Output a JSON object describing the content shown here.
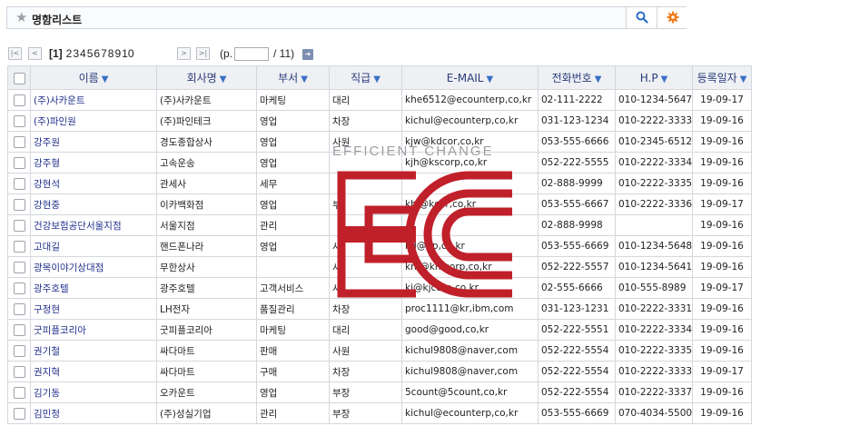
{
  "header": {
    "title": "명함리스트",
    "star_icon": "star-icon",
    "search_icon": "search-icon",
    "settings_icon": "gear-icon",
    "accent": "#f07a1a"
  },
  "pager": {
    "first": "|<",
    "prev": "<",
    "current": "[1]",
    "pages": [
      "2",
      "3",
      "4",
      "5",
      "6",
      "7",
      "8",
      "9",
      "10"
    ],
    "next": ">",
    "last": ">|",
    "page_prefix": "(p.",
    "page_value": "",
    "page_total": "/ 11)"
  },
  "table": {
    "columns": [
      "이름",
      "회사명",
      "부서",
      "직급",
      "E-MAIL",
      "전화번호",
      "H.P",
      "등록일자"
    ],
    "rows": [
      {
        "name": "(주)사카운트",
        "company": "(주)사카운트",
        "dept": "마케팅",
        "rank": "대리",
        "email": "khe6512@ecounterp,co,kr",
        "tel": "02-111-2222",
        "hp": "010-1234-5647",
        "date": "19-09-17"
      },
      {
        "name": "(주)파인원",
        "company": "(주)파인테크",
        "dept": "영업",
        "rank": "차장",
        "email": "kichul@ecounterp,co,kr",
        "tel": "031-123-1234",
        "hp": "010-2222-3333",
        "date": "19-09-16"
      },
      {
        "name": "강주원",
        "company": "경도종합상사",
        "dept": "영업",
        "rank": "사원",
        "email": "kjw@kdcor,co,kr",
        "tel": "053-555-6666",
        "hp": "010-2345-6512",
        "date": "19-09-16"
      },
      {
        "name": "강주형",
        "company": "고속운송",
        "dept": "영업",
        "rank": "",
        "email": "kjh@kscorp,co,kr",
        "tel": "052-222-5555",
        "hp": "010-2222-3334",
        "date": "19-09-16"
      },
      {
        "name": "강현석",
        "company": "관세사",
        "dept": "세무",
        "rank": "",
        "email": "",
        "tel": "02-888-9999",
        "hp": "010-2222-3335",
        "date": "19-09-16"
      },
      {
        "name": "강현중",
        "company": "이카백화점",
        "dept": "영업",
        "rank": "부",
        "email": "khj@kcor,co,kr",
        "tel": "053-555-6667",
        "hp": "010-2222-3336",
        "date": "19-09-17"
      },
      {
        "name": "건강보험공단서울지점",
        "company": "서울지점",
        "dept": "관리",
        "rank": "",
        "email": "",
        "tel": "02-888-9998",
        "hp": "",
        "date": "19-09-16"
      },
      {
        "name": "고대길",
        "company": "핸드폰나라",
        "dept": "영업",
        "rank": "사",
        "email": "kd@hp,co,kr",
        "tel": "053-555-6669",
        "hp": "010-1234-5648",
        "date": "19-09-16"
      },
      {
        "name": "광목이야기상대점",
        "company": "무한상사",
        "dept": "",
        "rank": "사",
        "email": "km@kmcorp,co,kr",
        "tel": "052-222-5557",
        "hp": "010-1234-5641",
        "date": "19-09-16"
      },
      {
        "name": "광주호텔",
        "company": "광주호텔",
        "dept": "고객서비스",
        "rank": "사",
        "email": "kj@kjcorp,co,kr",
        "tel": "02-555-6666",
        "hp": "010-555-8989",
        "date": "19-09-17"
      },
      {
        "name": "구정현",
        "company": "LH전자",
        "dept": "품질관리",
        "rank": "차장",
        "email": "proc1111@kr,ibm,com",
        "tel": "031-123-1231",
        "hp": "010-2222-3331",
        "date": "19-09-16"
      },
      {
        "name": "굿피플코리아",
        "company": "굿피플코리아",
        "dept": "마케팅",
        "rank": "대리",
        "email": "good@good,co,kr",
        "tel": "052-222-5551",
        "hp": "010-2222-3334",
        "date": "19-09-16"
      },
      {
        "name": "권기철",
        "company": "싸다마트",
        "dept": "판매",
        "rank": "사원",
        "email": "kichul9808@naver,com",
        "tel": "052-222-5554",
        "hp": "010-2222-3335",
        "date": "19-09-16"
      },
      {
        "name": "권지혁",
        "company": "싸다마트",
        "dept": "구매",
        "rank": "차장",
        "email": "kichul9808@naver,com",
        "tel": "052-222-5554",
        "hp": "010-2222-3333",
        "date": "19-09-17"
      },
      {
        "name": "김기동",
        "company": "오카운트",
        "dept": "영업",
        "rank": "부장",
        "email": "5count@5count,co,kr",
        "tel": "052-222-5554",
        "hp": "010-2222-3337",
        "date": "19-09-16"
      },
      {
        "name": "김민정",
        "company": "(주)성실기업",
        "dept": "관리",
        "rank": "부장",
        "email": "kichul@ecounterp,co,kr",
        "tel": "053-555-6669",
        "hp": "070-4034-5500",
        "date": "19-09-16"
      }
    ]
  },
  "watermark": {
    "tagline": "EFFICIENT CHANGE",
    "logo": "EC",
    "color": "#c0202a"
  }
}
